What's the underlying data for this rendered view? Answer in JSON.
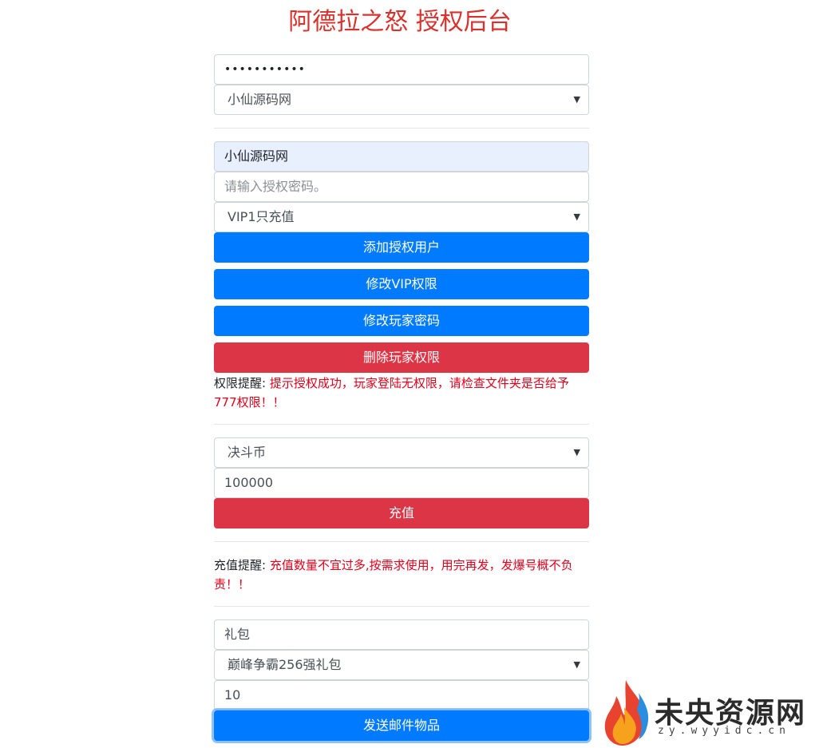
{
  "title": "阿德拉之怒 授权后台",
  "login": {
    "password_value": "•••••••••••",
    "server_select": "小仙源码网"
  },
  "auth": {
    "account_value": "小仙源码网",
    "password_placeholder": "请输入授权密码。",
    "vip_select": "VIP1只充值",
    "btn_add": "添加授权用户",
    "btn_vip": "修改VIP权限",
    "btn_pwd": "修改玩家密码",
    "btn_delete": "删除玩家权限",
    "note_label": "权限提醒:",
    "note_msg": "提示授权成功，玩家登陆无权限，请检查文件夹是否给予777权限！！"
  },
  "recharge": {
    "currency_select": "决斗币",
    "amount_value": "100000",
    "btn_recharge": "充值",
    "note_label": "充值提醒:",
    "note_msg": "充值数量不宜过多,按需求使用，用完再发，发爆号概不负责！！"
  },
  "mail": {
    "type_value": "礼包",
    "item_select": "巅峰争霸256强礼包",
    "qty_value": "10",
    "btn_send": "发送邮件物品"
  },
  "watermark": {
    "main": "未央资源网",
    "sub": "zy.wyyidc.cn"
  },
  "colors": {
    "primary": "#007bff",
    "danger": "#dc3545",
    "title": "#d9312b",
    "warning_text": "#e0001b"
  }
}
